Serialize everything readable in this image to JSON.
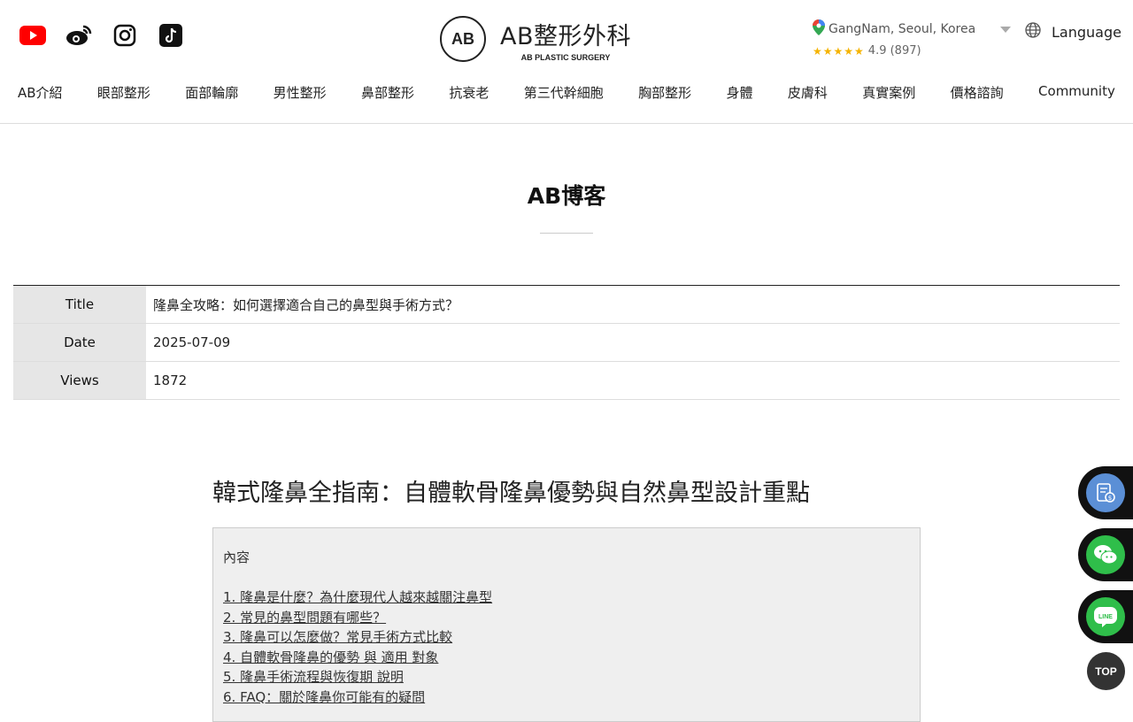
{
  "header": {
    "social_icons": [
      "youtube-icon",
      "weibo-icon",
      "instagram-icon",
      "tiktok-icon"
    ],
    "logo": {
      "mark": "AB",
      "title": "AB整形外科",
      "subtitle": "AB PLASTIC SURGERY"
    },
    "location": {
      "text": "GangNam, Seoul, Korea",
      "stars": "★★★★★",
      "rating": "4.9 (897)"
    },
    "language_label": "Language"
  },
  "nav": [
    "AB介紹",
    "眼部整形",
    "面部輪廓",
    "男性整形",
    "鼻部整形",
    "抗衰老",
    "第三代幹細胞",
    "胸部整形",
    "身體",
    "皮膚科",
    "真實案例",
    "價格諮詢",
    "Community"
  ],
  "page_title": "AB博客",
  "info": {
    "title_label": "Title",
    "title_value": "隆鼻全攻略：如何選擇適合自己的鼻型與手術方式？",
    "date_label": "Date",
    "date_value": "2025-07-09",
    "views_label": "Views",
    "views_value": "1872"
  },
  "article": {
    "heading": "韓式隆鼻全指南：自體軟骨隆鼻優勢與自然鼻型設計重點",
    "toc_heading": "內容",
    "toc": [
      "1. 隆鼻是什麼？為什麼現代人越來越關注鼻型",
      "2. 常見的鼻型問題有哪些？",
      "3. 隆鼻可以怎麼做？常見手術方式比較",
      "4. 自體軟骨隆鼻的優勢 與 適用 對象",
      "5. 隆鼻手術流程與恢復期 說明",
      "6. FAQ：關於隆鼻你可能有的疑問"
    ]
  },
  "floating": {
    "top_label": "TOP",
    "colors": {
      "consult": "#5b8fd6",
      "wechat": "#2fbe4a",
      "line": "#2fbe4a"
    }
  }
}
